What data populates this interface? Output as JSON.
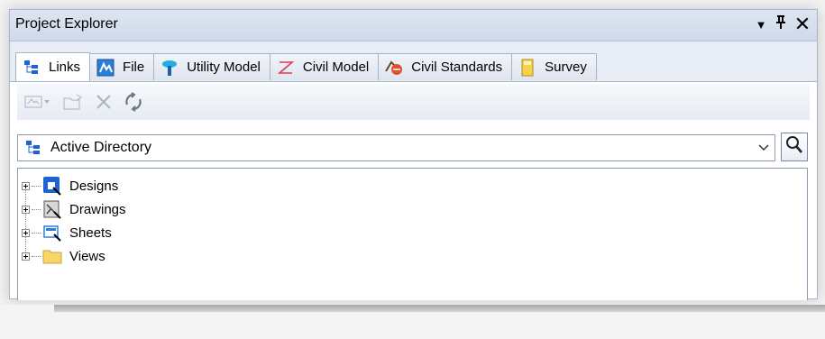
{
  "panel": {
    "title": "Project Explorer",
    "menu_glyph": "▼",
    "pin_glyph": "ᛘ",
    "close_glyph": "✕"
  },
  "tabs": [
    {
      "label": "Links",
      "icon": "links-tree-icon",
      "active": true
    },
    {
      "label": "File",
      "icon": "file-icon",
      "active": false
    },
    {
      "label": "Utility Model",
      "icon": "utility-model-icon",
      "active": false
    },
    {
      "label": "Civil Model",
      "icon": "civil-model-icon",
      "active": false
    },
    {
      "label": "Civil Standards",
      "icon": "civil-standards-icon",
      "active": false
    },
    {
      "label": "Survey",
      "icon": "survey-icon",
      "active": false
    }
  ],
  "toolbar": {
    "buttons": [
      "link-model-icon",
      "open-folder-icon",
      "delete-icon",
      "refresh-icon"
    ],
    "enabled": false
  },
  "directory": {
    "selected": "Active Directory"
  },
  "tree": [
    {
      "label": "Designs",
      "icon": "designs-icon"
    },
    {
      "label": "Drawings",
      "icon": "drawings-icon"
    },
    {
      "label": "Sheets",
      "icon": "sheets-icon"
    },
    {
      "label": "Views",
      "icon": "views-folder-icon"
    }
  ],
  "colors": {
    "title_bar": "#cfd9ea",
    "tab_border": "#a7b3c8",
    "accent_blue": "#1e63d6"
  }
}
